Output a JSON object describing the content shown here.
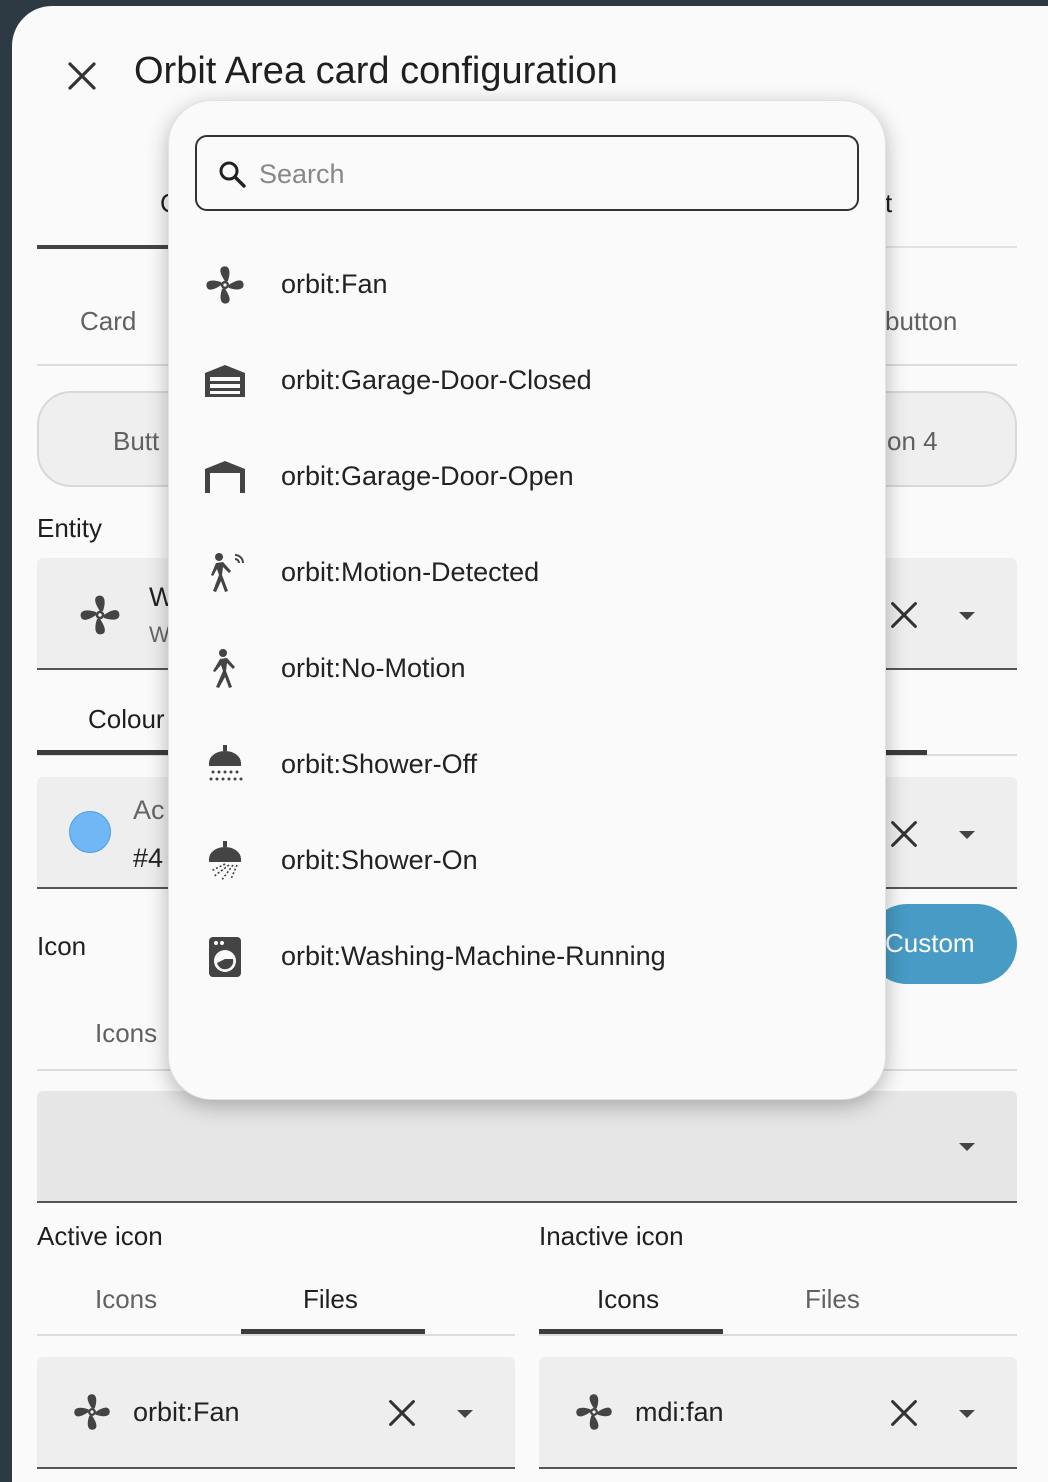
{
  "dialog": {
    "title": "Orbit Area card configuration"
  },
  "background": {
    "tab_partial_left": "C",
    "tab_partial_right": "t",
    "subtab_card": "Card",
    "subtab_button": "button",
    "pill_left": "Butt",
    "pill_right": "on 4",
    "entity_label": "Entity",
    "entity_name_partial": "W",
    "entity_sub_partial": "W",
    "colour_tab": "Colour",
    "colour_field_label": "Ac",
    "colour_field_value": "#4",
    "colour_swatch": "#6fb8f5",
    "icon_label": "Icon",
    "icons_tab": "Icons",
    "custom_button": "Custom",
    "accent_color": "#479bc4"
  },
  "active_icon": {
    "label": "Active icon",
    "tabs": [
      "Icons",
      "Files"
    ],
    "selected_tab": "Files",
    "value": "orbit:Fan"
  },
  "inactive_icon": {
    "label": "Inactive icon",
    "tabs": [
      "Icons",
      "Files"
    ],
    "selected_tab": "Icons",
    "value": "mdi:fan"
  },
  "picker": {
    "search_placeholder": "Search",
    "options": [
      {
        "label": "orbit:Fan",
        "icon": "fan-icon"
      },
      {
        "label": "orbit:Garage-Door-Closed",
        "icon": "garage-closed-icon"
      },
      {
        "label": "orbit:Garage-Door-Open",
        "icon": "garage-open-icon"
      },
      {
        "label": "orbit:Motion-Detected",
        "icon": "motion-detected-icon"
      },
      {
        "label": "orbit:No-Motion",
        "icon": "walk-icon"
      },
      {
        "label": "orbit:Shower-Off",
        "icon": "shower-off-icon"
      },
      {
        "label": "orbit:Shower-On",
        "icon": "shower-on-icon"
      },
      {
        "label": "orbit:Washing-Machine-Running",
        "icon": "washing-machine-icon"
      }
    ]
  }
}
